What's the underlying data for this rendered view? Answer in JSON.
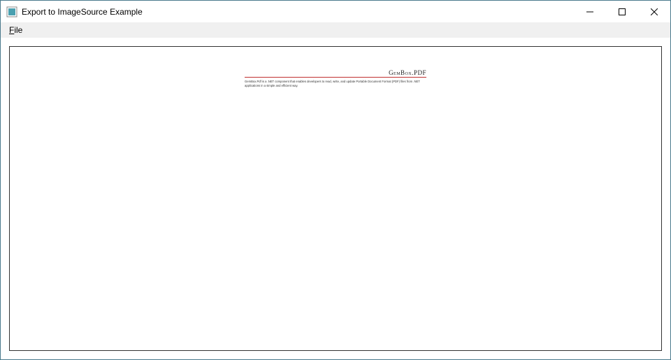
{
  "window": {
    "title": "Export to ImageSource Example"
  },
  "menu": {
    "file_label": "File",
    "file_mnemonic": "F"
  },
  "document": {
    "heading": "GemBox.PDF",
    "body": "GemBox.Pdf is a .NET component that enables developers to read, write, and update Portable Document Format (PDF) files from .NET applications in a simple and efficient way."
  }
}
